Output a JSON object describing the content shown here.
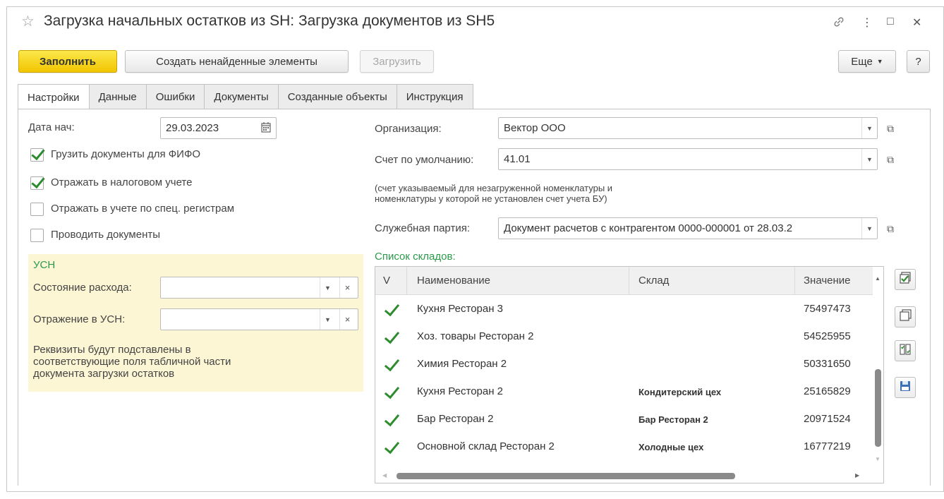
{
  "window": {
    "title": "Загрузка начальных остатков из SH: Загрузка документов из SH5",
    "star_icon": "☆",
    "link_icon": "🔗",
    "more_icon": "⋮",
    "maximize_icon": "□",
    "close_icon": "✕"
  },
  "toolbar": {
    "fill_label": "Заполнить",
    "create_missing_label": "Создать ненайденные элементы",
    "load_label": "Загрузить",
    "more_label": "Еще",
    "help_label": "?"
  },
  "tabs": [
    {
      "label": "Настройки",
      "active": true
    },
    {
      "label": "Данные",
      "active": false
    },
    {
      "label": "Ошибки",
      "active": false
    },
    {
      "label": "Документы",
      "active": false
    },
    {
      "label": "Созданные объекты",
      "active": false
    },
    {
      "label": "Инструкция",
      "active": false
    }
  ],
  "settings": {
    "start_date_label": "Дата нач:",
    "start_date_value": "29.03.2023",
    "checkboxes": [
      {
        "label": "Грузить документы для ФИФО",
        "checked": true
      },
      {
        "label": "Отражать в налоговом учете",
        "checked": true
      },
      {
        "label": "Отражать в учете по спец. регистрам",
        "checked": false
      },
      {
        "label": "Проводить документы",
        "checked": false
      }
    ]
  },
  "usn": {
    "heading": "УСН",
    "expense_state_label": "Состояние расхода:",
    "expense_state_value": "",
    "usn_reflection_label": "Отражение в УСН:",
    "usn_reflection_value": "",
    "note_line1": "Реквизиты будут подставлены в",
    "note_line2": "соответствующие поля табличной части",
    "note_line3": "документа загрузки остатков"
  },
  "right": {
    "org_label": "Организация:",
    "org_value": "Вектор ООО",
    "account_label": "Счет по умолчанию:",
    "account_value": "41.01",
    "account_note_line1": "(счет указываемый для незагруженной номенклатуры и",
    "account_note_line2": "номенклатуры у которой не установлен счет учета БУ)",
    "batch_label": "Служебная партия:",
    "batch_value": "Документ расчетов с контрагентом 0000-000001 от 28.03.2",
    "warehouses_title": "Список складов:"
  },
  "grid": {
    "columns": [
      "V",
      "Наименование",
      "Склад",
      "Значение"
    ],
    "rows": [
      {
        "checked": true,
        "name": "Кухня Ресторан 3",
        "warehouse": "",
        "value": "75497473"
      },
      {
        "checked": true,
        "name": "Хоз. товары Ресторан 2",
        "warehouse": "",
        "value": "54525955"
      },
      {
        "checked": true,
        "name": "Химия Ресторан 2",
        "warehouse": "",
        "value": "50331650"
      },
      {
        "checked": true,
        "name": "Кухня Ресторан 2",
        "warehouse": "Кондитерский цех",
        "value": "25165829"
      },
      {
        "checked": true,
        "name": "Бар Ресторан 2",
        "warehouse": "Бар Ресторан 2",
        "value": "20971524"
      },
      {
        "checked": true,
        "name": "Основной склад Ресторан 2",
        "warehouse": "Холодные цех",
        "value": "16777219"
      }
    ]
  },
  "colors": {
    "accent_yellow": "#f2c500",
    "title_green": "#2a9a4a",
    "check_green": "#2e8b2e",
    "usn_bg": "#fcf6d4"
  }
}
